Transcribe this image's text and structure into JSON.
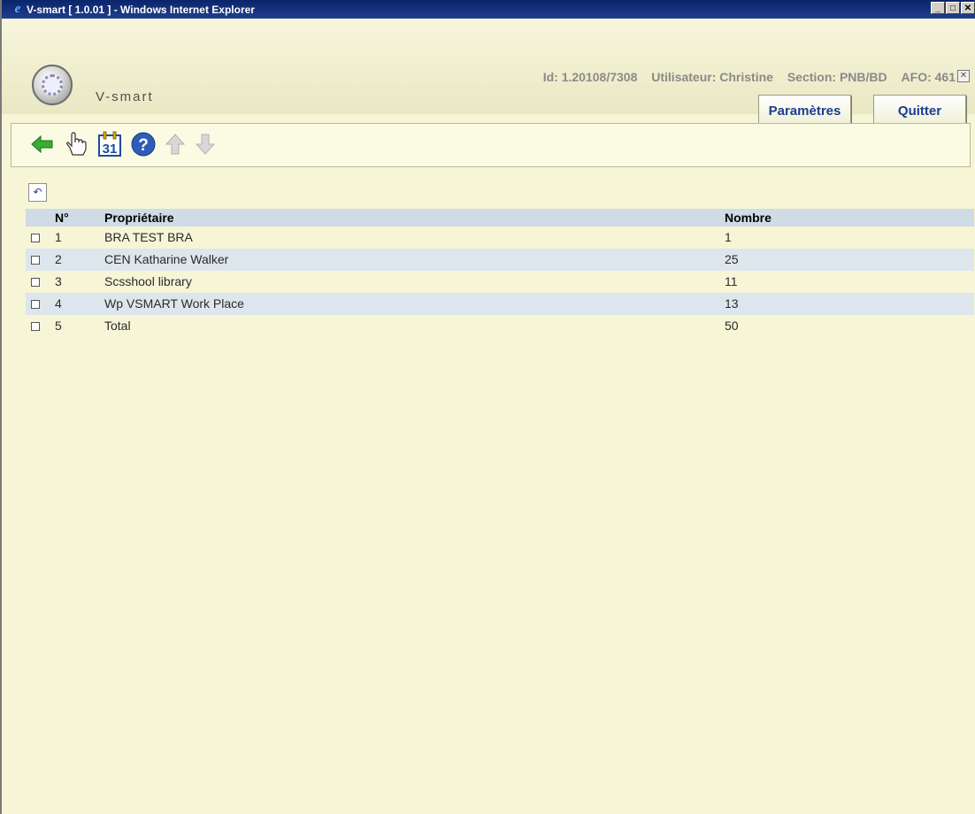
{
  "window": {
    "title": "V-smart [ 1.0.01 ] - Windows Internet Explorer"
  },
  "header": {
    "logo_text": "V-smart",
    "id": "Id: 1.20108/7308",
    "user": "Utilisateur: Christine",
    "section": "Section: PNB/BD",
    "afo": "AFO: 461",
    "buttons": {
      "params": "Paramètres",
      "quit": "Quitter"
    }
  },
  "toolbar": {
    "icons": [
      "back-arrow-icon",
      "hand-select-icon",
      "calendar-31-icon",
      "help-icon",
      "arrow-up-icon",
      "arrow-down-icon"
    ],
    "calendar_label": "31"
  },
  "table": {
    "columns": {
      "num": "N°",
      "owner": "Propriétaire",
      "count": "Nombre"
    },
    "rows": [
      {
        "num": "1",
        "owner": "BRA TEST BRA",
        "count": "1"
      },
      {
        "num": "2",
        "owner": "CEN Katharine Walker",
        "count": "25"
      },
      {
        "num": "3",
        "owner": "Scsshool library",
        "count": "11"
      },
      {
        "num": "4",
        "owner": "Wp VSMART Work Place",
        "count": "13"
      },
      {
        "num": "5",
        "owner": "Total",
        "count": "50"
      }
    ]
  },
  "colors": {
    "background": "#f6f5d6",
    "header_row": "#cfdce6",
    "alt_row": "#dde6ed",
    "button_text": "#1a3d8f"
  }
}
